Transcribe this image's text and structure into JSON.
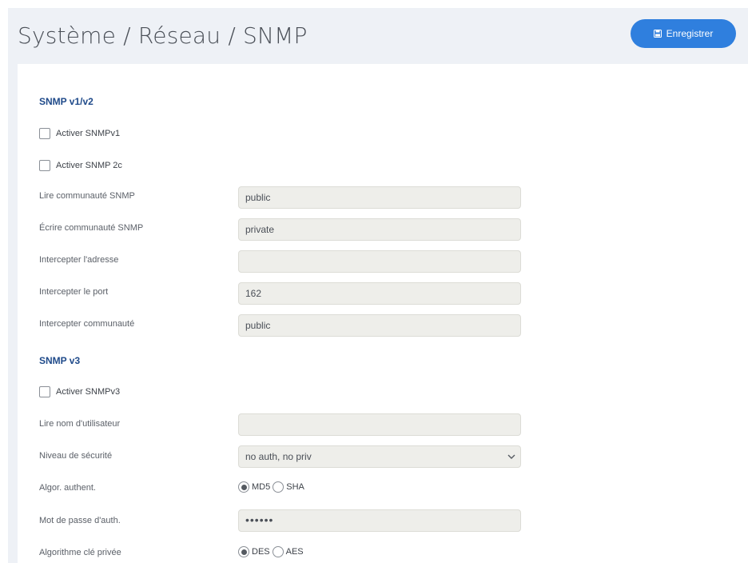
{
  "header": {
    "title": "Système / Réseau / SNMP",
    "save_label": "Enregistrer",
    "save_icon": "floppy-disk-icon",
    "accent": "#2f7fde"
  },
  "snmp_v1v2": {
    "title": "SNMP v1/v2",
    "enable_v1": {
      "label": "Activer SNMPv1",
      "checked": false
    },
    "enable_2c": {
      "label": "Activer SNMP 2c",
      "checked": false
    },
    "read_community": {
      "label": "Lire communauté SNMP",
      "value": "public"
    },
    "write_community": {
      "label": "Écrire communauté SNMP",
      "value": "private"
    },
    "trap_address": {
      "label": "Intercepter l'adresse",
      "value": ""
    },
    "trap_port": {
      "label": "Intercepter le port",
      "value": "162"
    },
    "trap_community": {
      "label": "Intercepter communauté",
      "value": "public"
    }
  },
  "snmp_v3": {
    "title": "SNMP v3",
    "enable_v3": {
      "label": "Activer SNMPv3",
      "checked": false
    },
    "read_username": {
      "label": "Lire nom d'utilisateur",
      "value": ""
    },
    "security_level": {
      "label": "Niveau de sécurité",
      "value": "no auth, no priv"
    },
    "auth_algo": {
      "label": "Algor. authent.",
      "options": [
        "MD5",
        "SHA"
      ],
      "selected": "MD5"
    },
    "auth_password": {
      "label": "Mot de passe d'auth.",
      "value": "••••••"
    },
    "priv_algo": {
      "label": "Algorithme clé privée",
      "options": [
        "DES",
        "AES"
      ],
      "selected": "DES"
    }
  }
}
